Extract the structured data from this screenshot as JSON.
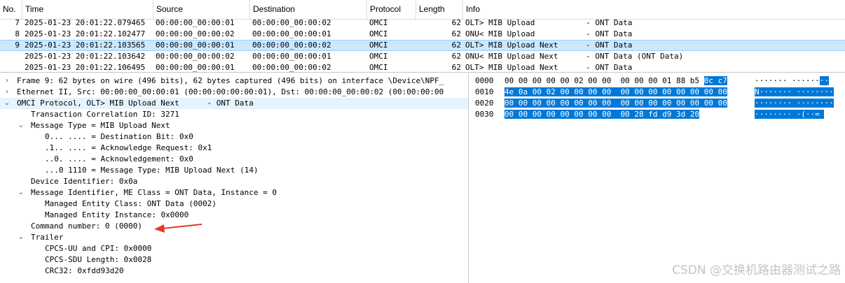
{
  "packet_list": {
    "columns": [
      "No.",
      "Time",
      "Source",
      "Destination",
      "Protocol",
      "Length",
      "Info"
    ],
    "rows": [
      {
        "no": "7",
        "time": "2025-01-23 20:01:22.079465",
        "src": "00:00:00_00:00:01",
        "dst": "00:00:00_00:00:02",
        "proto": "OMCI",
        "len": "62",
        "info": "OLT> MIB Upload           - ONT Data"
      },
      {
        "no": "8",
        "time": "2025-01-23 20:01:22.102477",
        "src": "00:00:00_00:00:02",
        "dst": "00:00:00_00:00:01",
        "proto": "OMCI",
        "len": "62",
        "info": "ONU< MIB Upload           - ONT Data"
      },
      {
        "no": "9",
        "time": "2025-01-23 20:01:22.103565",
        "src": "00:00:00_00:00:01",
        "dst": "00:00:00_00:00:02",
        "proto": "OMCI",
        "len": "62",
        "info": "OLT> MIB Upload Next      - ONT Data"
      },
      {
        "no": "",
        "time": "2025-01-23 20:01:22.103642",
        "src": "00:00:00_00:00:02",
        "dst": "00:00:00_00:00:01",
        "proto": "OMCI",
        "len": "62",
        "info": "ONU< MIB Upload Next      - ONT Data (ONT Data)"
      },
      {
        "no": "",
        "time": "2025-01-23 20:01:22.106495",
        "src": "00:00:00_00:00:01",
        "dst": "00:00:00_00:00:02",
        "proto": "OMCI",
        "len": "62",
        "info": "OLT> MIB Upload Next      - ONT Data"
      }
    ]
  },
  "details": [
    {
      "text": "Frame 9: 62 bytes on wire (496 bits), 62 bytes captured (496 bits) on interface \\Device\\NPF_",
      "indent": 0,
      "arrow": "right"
    },
    {
      "text": "Ethernet II, Src: 00:00:00_00:00:01 (00:00:00:00:00:01), Dst: 00:00:00_00:00:02 (00:00:00:00",
      "indent": 0,
      "arrow": "right"
    },
    {
      "text": "OMCI Protocol, OLT> MIB Upload Next      - ONT Data",
      "indent": 0,
      "arrow": "down"
    },
    {
      "text": "Transaction Correlation ID: 3271",
      "indent": 1,
      "arrow": ""
    },
    {
      "text": "Message Type = MIB Upload Next",
      "indent": 1,
      "arrow": "down"
    },
    {
      "text": "0... .... = Destination Bit: 0x0",
      "indent": 2,
      "arrow": ""
    },
    {
      "text": ".1.. .... = Acknowledge Request: 0x1",
      "indent": 2,
      "arrow": ""
    },
    {
      "text": "..0. .... = Acknowledgement: 0x0",
      "indent": 2,
      "arrow": ""
    },
    {
      "text": "...0 1110 = Message Type: MIB Upload Next (14)",
      "indent": 2,
      "arrow": ""
    },
    {
      "text": "Device Identifier: 0x0a",
      "indent": 1,
      "arrow": ""
    },
    {
      "text": "Message Identifier, ME Class = ONT Data, Instance = 0",
      "indent": 1,
      "arrow": "down"
    },
    {
      "text": "Managed Entity Class: ONT Data (0002)",
      "indent": 2,
      "arrow": ""
    },
    {
      "text": "Managed Entity Instance: 0x0000",
      "indent": 2,
      "arrow": ""
    },
    {
      "text": "Command number: 0 (0000)",
      "indent": 1,
      "arrow": ""
    },
    {
      "text": "Trailer",
      "indent": 1,
      "arrow": "down"
    },
    {
      "text": "CPCS-UU and CPI: 0x0000",
      "indent": 2,
      "arrow": ""
    },
    {
      "text": "CPCS-SDU Length: 0x0028",
      "indent": 2,
      "arrow": ""
    },
    {
      "text": "CRC32: 0xfdd93d20",
      "indent": 2,
      "arrow": ""
    }
  ],
  "bytes": [
    {
      "offset": "0000",
      "hex_plain": "00 00 00 00 00 02 00 00  00 00 00 01 88 b5 ",
      "hex_hl": "0c c7",
      "ascii_plain": "······· ······",
      "ascii_hl": "··"
    },
    {
      "offset": "0010",
      "hex_plain": "",
      "hex_hl": "4e 0a 00 02 00 00 00 00  00 00 00 00 00 00 00 00",
      "ascii_plain": "",
      "ascii_hl": "N······· ········"
    },
    {
      "offset": "0020",
      "hex_plain": "",
      "hex_hl": "00 00 00 00 00 00 00 00  00 00 00 00 00 00 00 00",
      "ascii_plain": "",
      "ascii_hl": "········ ········"
    },
    {
      "offset": "0030",
      "hex_plain": "",
      "hex_hl": "00 00 00 00 00 00 00 00  00 28 fd d9 3d 20",
      "ascii_plain": "",
      "ascii_hl": "········ ·(··= "
    }
  ],
  "watermark": "CSDN @交换机路由器测试之路",
  "colors": {
    "selection": "#cce8ff",
    "bytes_highlight": "#0078d7",
    "arrow_annotation": "#e8372a"
  }
}
